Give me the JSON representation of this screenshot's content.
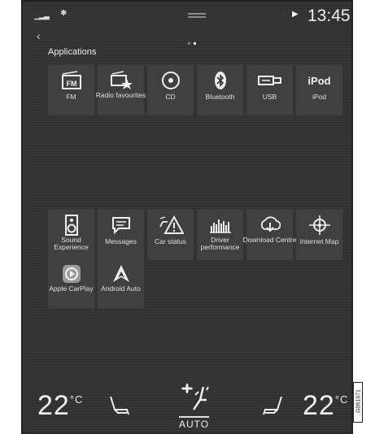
{
  "status": {
    "time": "13:45"
  },
  "section_title": "Applications",
  "apps": [
    {
      "label": "FM",
      "icon": "fm-radio-icon"
    },
    {
      "label": "Radio favourites",
      "icon": "radio-favourites-icon"
    },
    {
      "label": "CD",
      "icon": "cd-icon"
    },
    {
      "label": "Bluetooth",
      "icon": "bluetooth-icon"
    },
    {
      "label": "USB",
      "icon": "usb-icon"
    },
    {
      "label": "iPod",
      "icon": "ipod-icon",
      "icon_text": "iPod"
    },
    {
      "label": "Sound Experience",
      "icon": "speaker-icon"
    },
    {
      "label": "Messages",
      "icon": "message-icon"
    },
    {
      "label": "Car status",
      "icon": "car-warning-icon"
    },
    {
      "label": "Driver performance",
      "icon": "performance-chart-icon"
    },
    {
      "label": "Download Centre",
      "icon": "download-icon"
    },
    {
      "label": "Internet Map",
      "icon": "map-crosshair-icon"
    },
    {
      "label": "Apple CarPlay",
      "icon": "carplay-icon"
    },
    {
      "label": "Android Auto",
      "icon": "android-auto-icon"
    }
  ],
  "climate": {
    "left_temp": "22",
    "right_temp": "22",
    "unit": "°C",
    "mode": "AUTO"
  },
  "image_code": "G061971"
}
